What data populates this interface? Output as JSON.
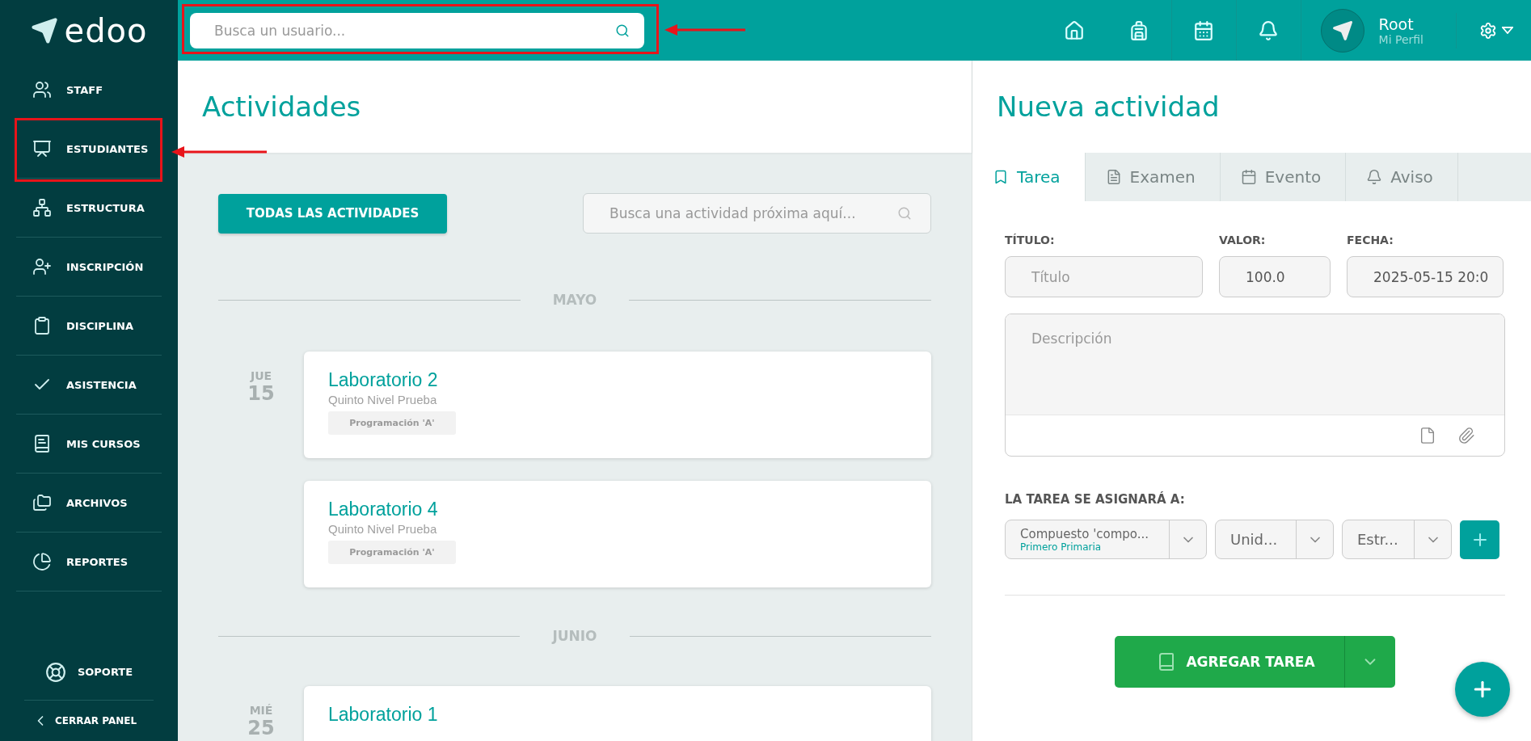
{
  "sidebar": {
    "logo": "edoo",
    "items": [
      {
        "label": "STAFF"
      },
      {
        "label": "ESTUDIANTES"
      },
      {
        "label": "ESTRUCTURA"
      },
      {
        "label": "INSCRIPCIÓN"
      },
      {
        "label": "DISCIPLINA"
      },
      {
        "label": "ASISTENCIA"
      },
      {
        "label": "MIS CURSOS"
      },
      {
        "label": "ARCHIVOS"
      },
      {
        "label": "REPORTES"
      }
    ],
    "support": "SOPORTE",
    "collapse": "CERRAR PANEL"
  },
  "topbar": {
    "search_placeholder": "Busca un usuario...",
    "user_name": "Root",
    "user_link": "Mi Perfil"
  },
  "activities": {
    "title": "Actividades",
    "all_button": "TODAS LAS ACTIVIDADES",
    "search_placeholder": "Busca una actividad próxima aquí...",
    "months": [
      {
        "month": "MAYO",
        "days": [
          {
            "weekday": "JUE",
            "day": "15",
            "items": [
              {
                "title": "Laboratorio 2",
                "subtitle": "Quinto Nivel Prueba",
                "tag": "Programación 'A'"
              },
              {
                "title": "Laboratorio 4",
                "subtitle": "Quinto Nivel Prueba",
                "tag": "Programación 'A'"
              }
            ]
          }
        ]
      },
      {
        "month": "JUNIO",
        "days": [
          {
            "weekday": "MIÉ",
            "day": "25",
            "items": [
              {
                "title": "Laboratorio 1"
              }
            ]
          }
        ]
      }
    ]
  },
  "new_activity": {
    "title": "Nueva actividad",
    "tabs": [
      {
        "label": "Tarea",
        "selected": true
      },
      {
        "label": "Examen",
        "selected": false
      },
      {
        "label": "Evento",
        "selected": false
      },
      {
        "label": "Aviso",
        "selected": false
      }
    ],
    "fields": [
      {
        "label": "TÍTULO:",
        "placeholder": "Título"
      },
      {
        "label": "VALOR:",
        "value": "100.0"
      },
      {
        "label": "FECHA:",
        "value": "2025-05-15 20:0"
      }
    ],
    "description_placeholder": "Descripción",
    "assign_label": "LA TAREA SE ASIGNARÁ A:",
    "selects": [
      {
        "value": "Compuesto 'compo...",
        "sub": "Primero Primaria"
      },
      {
        "value": "Unid..."
      },
      {
        "value": "Estr..."
      }
    ],
    "submit": "AGREGAR TAREA"
  }
}
